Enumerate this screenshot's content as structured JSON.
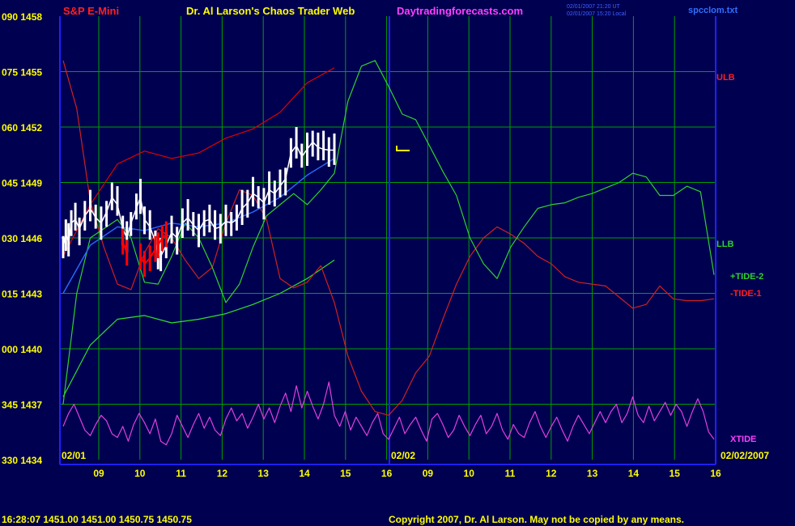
{
  "header": {
    "instrument": "S&P E-Mini",
    "title": "Dr. Al Larson's Chaos Trader Web",
    "site": "Daytradingforecasts.com",
    "stamp_line1": "02/01/2007 21:20 UT",
    "stamp_line2": "02/01/2007 15:20 Local",
    "file": "spcclom.txt"
  },
  "footer": {
    "quote": "16:28:07  1451.00 1451.00 1450.75 1450.75",
    "copyright": "Copyright 2007, Dr. Al Larson. May not be copied by any means."
  },
  "colors": {
    "background": "#000050",
    "grid": "#00a000",
    "axis": "#2020ff",
    "price_bars": "#ffffff",
    "price_bars_down": "#ff0000",
    "ulb_band": "#e00000",
    "llb_band": "#30e030",
    "tide2": "#30d030",
    "tide1": "#d02020",
    "xtide": "#e040e0",
    "avg_line": "#2a6bff",
    "label_yellow": "#ffff00",
    "label_red": "#ff2020",
    "label_magenta": "#ff40ff"
  },
  "chart_data": {
    "type": "line",
    "y_left_labels": [
      "090 1458",
      "075 1455",
      "060 1452",
      "045 1449",
      "030 1446",
      "015 1443",
      "000 1440",
      "345 1437",
      "330 1434"
    ],
    "y_price_values": [
      1458,
      1455,
      1452,
      1449,
      1446,
      1443,
      1440,
      1437,
      1434
    ],
    "ylim": [
      1434,
      1458
    ],
    "x_hour_ticks": [
      "09",
      "10",
      "11",
      "12",
      "13",
      "14",
      "15",
      "16",
      "09",
      "10",
      "11",
      "12",
      "13",
      "14",
      "15",
      "16"
    ],
    "date_labels": [
      "02/01",
      "02/02",
      "02/02/2007"
    ],
    "grid": true,
    "series_labels": [
      {
        "name": "ULB"
      },
      {
        "name": "LLB"
      },
      {
        "name": "+TIDE-2"
      },
      {
        "name": "-TIDE-1"
      },
      {
        "name": "XTIDE"
      }
    ],
    "xlim": [
      0,
      16
    ],
    "price_close": [
      [
        0.0,
        1445.5
      ],
      [
        0.1,
        1446.2
      ],
      [
        0.2,
        1445.8
      ],
      [
        0.3,
        1446.8
      ],
      [
        0.45,
        1447.0
      ],
      [
        0.6,
        1446.5
      ],
      [
        0.8,
        1447.2
      ],
      [
        1.0,
        1447.6
      ],
      [
        1.2,
        1447.1
      ],
      [
        1.4,
        1446.8
      ],
      [
        1.6,
        1447.4
      ],
      [
        1.8,
        1448.2
      ],
      [
        2.0,
        1447.8
      ],
      [
        2.2,
        1446.5
      ],
      [
        2.35,
        1446.0
      ],
      [
        2.5,
        1446.8
      ],
      [
        2.7,
        1447.6
      ],
      [
        2.85,
        1448.2
      ],
      [
        3.0,
        1447.0
      ],
      [
        3.2,
        1446.6
      ],
      [
        3.4,
        1445.8
      ],
      [
        3.5,
        1445.2
      ],
      [
        3.6,
        1445.0
      ],
      [
        3.8,
        1445.6
      ],
      [
        4.0,
        1446.3
      ],
      [
        4.2,
        1446.0
      ],
      [
        4.4,
        1446.8
      ],
      [
        4.6,
        1447.1
      ],
      [
        4.8,
        1446.7
      ],
      [
        5.0,
        1446.4
      ],
      [
        5.2,
        1446.9
      ],
      [
        5.4,
        1447.0
      ],
      [
        5.6,
        1446.5
      ],
      [
        5.8,
        1446.6
      ],
      [
        6.0,
        1446.9
      ],
      [
        6.2,
        1446.8
      ],
      [
        6.4,
        1447.0
      ],
      [
        6.6,
        1447.6
      ],
      [
        6.8,
        1447.9
      ],
      [
        7.0,
        1448.4
      ],
      [
        7.2,
        1448.2
      ],
      [
        7.4,
        1447.9
      ],
      [
        7.6,
        1448.6
      ],
      [
        7.8,
        1448.4
      ],
      [
        8.0,
        1448.8
      ],
      [
        8.2,
        1449.2
      ],
      [
        8.4,
        1450.6
      ],
      [
        8.6,
        1451.0
      ],
      [
        8.8,
        1450.4
      ],
      [
        9.0,
        1450.8
      ],
      [
        9.2,
        1451.2
      ],
      [
        9.4,
        1450.9
      ],
      [
        9.6,
        1450.8
      ],
      [
        9.8,
        1450.75
      ],
      [
        10.0,
        1450.75
      ]
    ],
    "price_down_segments": [
      [
        [
          2.2,
          1445.8
        ],
        [
          2.35,
          1445.2
        ]
      ],
      [
        [
          2.85,
          1445.0
        ],
        [
          3.0,
          1444.6
        ],
        [
          3.2,
          1444.9
        ],
        [
          3.4,
          1445.4
        ]
      ],
      [
        [
          3.5,
          1445.6
        ],
        [
          3.65,
          1446.0
        ],
        [
          3.8,
          1446.2
        ]
      ]
    ],
    "avg_line": [
      [
        0.0,
        1443.0
      ],
      [
        1.0,
        1445.6
      ],
      [
        2.0,
        1446.6
      ],
      [
        3.0,
        1446.4
      ],
      [
        4.0,
        1446.8
      ],
      [
        5.0,
        1446.6
      ],
      [
        6.0,
        1446.8
      ],
      [
        7.0,
        1447.4
      ],
      [
        8.0,
        1448.2
      ],
      [
        9.0,
        1449.4
      ],
      [
        10.0,
        1450.3
      ]
    ],
    "ulb_band": [
      [
        0.0,
        1445.0
      ],
      [
        1.0,
        1447.8
      ],
      [
        2.0,
        1450.0
      ],
      [
        3.0,
        1450.7
      ],
      [
        4.0,
        1450.3
      ],
      [
        5.0,
        1450.6
      ],
      [
        6.0,
        1451.4
      ],
      [
        7.0,
        1451.9
      ],
      [
        8.0,
        1452.8
      ],
      [
        9.0,
        1454.4
      ],
      [
        10.0,
        1455.2
      ]
    ],
    "llb_band": [
      [
        0.0,
        1437.4
      ],
      [
        1.0,
        1440.2
      ],
      [
        2.0,
        1441.6
      ],
      [
        3.0,
        1441.8
      ],
      [
        4.0,
        1441.4
      ],
      [
        5.0,
        1441.6
      ],
      [
        6.0,
        1441.9
      ],
      [
        7.0,
        1442.4
      ],
      [
        8.0,
        1443.0
      ],
      [
        9.0,
        1443.8
      ],
      [
        10.0,
        1444.8
      ]
    ],
    "tide2": [
      [
        0.0,
        1437.0
      ],
      [
        0.5,
        1443.0
      ],
      [
        1.0,
        1446.0
      ],
      [
        1.5,
        1446.5
      ],
      [
        2.0,
        1447.0
      ],
      [
        2.5,
        1446.0
      ],
      [
        3.0,
        1443.6
      ],
      [
        3.5,
        1443.5
      ],
      [
        4.0,
        1445.0
      ],
      [
        4.5,
        1446.8
      ],
      [
        5.0,
        1446.0
      ],
      [
        5.5,
        1444.4
      ],
      [
        6.0,
        1442.5
      ],
      [
        6.5,
        1443.5
      ],
      [
        7.0,
        1445.5
      ],
      [
        7.5,
        1447.2
      ],
      [
        8.0,
        1447.8
      ],
      [
        8.5,
        1448.4
      ],
      [
        9.0,
        1447.8
      ],
      [
        9.5,
        1448.6
      ],
      [
        10.0,
        1449.5
      ],
      [
        10.5,
        1453.4
      ],
      [
        11.0,
        1455.3
      ],
      [
        11.5,
        1455.6
      ],
      [
        12.0,
        1454.2
      ],
      [
        12.5,
        1452.7
      ],
      [
        13.0,
        1452.4
      ],
      [
        13.5,
        1451.0
      ],
      [
        14.0,
        1449.6
      ],
      [
        14.5,
        1448.3
      ],
      [
        15.0,
        1446.0
      ],
      [
        15.5,
        1444.6
      ],
      [
        16.0,
        1443.8
      ],
      [
        16.5,
        1445.5
      ],
      [
        17.0,
        1446.6
      ],
      [
        17.5,
        1447.6
      ],
      [
        18.0,
        1447.8
      ],
      [
        18.5,
        1447.9
      ],
      [
        19.0,
        1448.2
      ],
      [
        19.5,
        1448.4
      ],
      [
        20.0,
        1448.7
      ],
      [
        20.5,
        1449.0
      ],
      [
        21.0,
        1449.5
      ],
      [
        21.5,
        1449.3
      ],
      [
        22.0,
        1448.3
      ],
      [
        22.5,
        1448.3
      ],
      [
        23.0,
        1448.8
      ],
      [
        23.5,
        1448.5
      ],
      [
        24.0,
        1444.0
      ]
    ],
    "tide1": [
      [
        0.0,
        1455.6
      ],
      [
        0.5,
        1453.0
      ],
      [
        1.0,
        1448.0
      ],
      [
        1.5,
        1445.5
      ],
      [
        2.0,
        1443.5
      ],
      [
        2.5,
        1443.2
      ],
      [
        3.0,
        1445.2
      ],
      [
        3.5,
        1446.5
      ],
      [
        4.0,
        1446.0
      ],
      [
        4.5,
        1444.8
      ],
      [
        5.0,
        1443.8
      ],
      [
        5.5,
        1444.4
      ],
      [
        6.0,
        1446.8
      ],
      [
        6.5,
        1448.6
      ],
      [
        7.0,
        1448.3
      ],
      [
        7.5,
        1447.0
      ],
      [
        8.0,
        1443.8
      ],
      [
        8.5,
        1443.3
      ],
      [
        9.0,
        1443.6
      ],
      [
        9.5,
        1444.5
      ],
      [
        10.0,
        1442.5
      ],
      [
        10.5,
        1439.6
      ],
      [
        11.0,
        1437.7
      ],
      [
        11.5,
        1436.6
      ],
      [
        12.0,
        1436.4
      ],
      [
        12.5,
        1437.2
      ],
      [
        13.0,
        1438.7
      ],
      [
        13.5,
        1439.6
      ],
      [
        14.0,
        1441.6
      ],
      [
        14.5,
        1443.5
      ],
      [
        15.0,
        1445.0
      ],
      [
        15.5,
        1446.0
      ],
      [
        16.0,
        1446.6
      ],
      [
        16.5,
        1446.2
      ],
      [
        17.0,
        1445.7
      ],
      [
        17.5,
        1445.0
      ],
      [
        18.0,
        1444.6
      ],
      [
        18.5,
        1443.9
      ],
      [
        19.0,
        1443.6
      ],
      [
        19.5,
        1443.5
      ],
      [
        20.0,
        1443.4
      ],
      [
        20.5,
        1442.8
      ],
      [
        21.0,
        1442.2
      ],
      [
        21.5,
        1442.4
      ],
      [
        22.0,
        1443.4
      ],
      [
        22.5,
        1442.7
      ],
      [
        23.0,
        1442.6
      ],
      [
        23.5,
        1442.6
      ],
      [
        24.0,
        1442.7
      ]
    ],
    "xtide": [
      [
        0.0,
        1435.8
      ],
      [
        0.2,
        1436.5
      ],
      [
        0.4,
        1437.0
      ],
      [
        0.6,
        1436.3
      ],
      [
        0.8,
        1435.6
      ],
      [
        1.0,
        1435.3
      ],
      [
        1.2,
        1435.9
      ],
      [
        1.4,
        1436.4
      ],
      [
        1.6,
        1436.1
      ],
      [
        1.8,
        1435.4
      ],
      [
        2.0,
        1435.2
      ],
      [
        2.2,
        1435.8
      ],
      [
        2.4,
        1435.0
      ],
      [
        2.6,
        1435.9
      ],
      [
        2.8,
        1436.5
      ],
      [
        3.0,
        1436.0
      ],
      [
        3.2,
        1435.4
      ],
      [
        3.4,
        1436.2
      ],
      [
        3.6,
        1435.0
      ],
      [
        3.8,
        1434.8
      ],
      [
        4.0,
        1435.4
      ],
      [
        4.2,
        1436.4
      ],
      [
        4.4,
        1435.8
      ],
      [
        4.6,
        1435.2
      ],
      [
        4.8,
        1435.9
      ],
      [
        5.0,
        1436.5
      ],
      [
        5.2,
        1435.7
      ],
      [
        5.4,
        1436.3
      ],
      [
        5.6,
        1435.6
      ],
      [
        5.8,
        1435.3
      ],
      [
        6.0,
        1436.2
      ],
      [
        6.2,
        1436.8
      ],
      [
        6.4,
        1436.1
      ],
      [
        6.6,
        1436.5
      ],
      [
        6.8,
        1435.7
      ],
      [
        7.0,
        1436.3
      ],
      [
        7.2,
        1437.0
      ],
      [
        7.4,
        1436.2
      ],
      [
        7.6,
        1436.8
      ],
      [
        7.8,
        1436.0
      ],
      [
        8.0,
        1436.9
      ],
      [
        8.2,
        1437.6
      ],
      [
        8.4,
        1436.6
      ],
      [
        8.6,
        1438.0
      ],
      [
        8.8,
        1436.8
      ],
      [
        9.0,
        1437.7
      ],
      [
        9.2,
        1436.9
      ],
      [
        9.4,
        1436.2
      ],
      [
        9.6,
        1437.0
      ],
      [
        9.8,
        1438.2
      ],
      [
        10.0,
        1436.4
      ],
      [
        10.2,
        1435.8
      ],
      [
        10.4,
        1436.6
      ],
      [
        10.6,
        1435.6
      ],
      [
        10.8,
        1436.3
      ],
      [
        11.0,
        1435.8
      ],
      [
        11.2,
        1435.3
      ],
      [
        11.4,
        1436.0
      ],
      [
        11.6,
        1436.5
      ],
      [
        11.8,
        1435.4
      ],
      [
        12.0,
        1435.1
      ],
      [
        12.2,
        1435.7
      ],
      [
        12.4,
        1436.3
      ],
      [
        12.6,
        1435.4
      ],
      [
        12.8,
        1435.9
      ],
      [
        13.0,
        1436.3
      ],
      [
        13.2,
        1435.6
      ],
      [
        13.4,
        1435.0
      ],
      [
        13.6,
        1436.2
      ],
      [
        13.8,
        1436.5
      ],
      [
        14.0,
        1435.9
      ],
      [
        14.2,
        1435.2
      ],
      [
        14.4,
        1435.6
      ],
      [
        14.6,
        1436.4
      ],
      [
        14.8,
        1435.8
      ],
      [
        15.0,
        1435.3
      ],
      [
        15.2,
        1435.9
      ],
      [
        15.4,
        1436.4
      ],
      [
        15.6,
        1435.4
      ],
      [
        15.8,
        1435.8
      ],
      [
        16.0,
        1436.5
      ],
      [
        16.2,
        1435.6
      ],
      [
        16.4,
        1435.1
      ],
      [
        16.6,
        1435.9
      ],
      [
        16.8,
        1435.4
      ],
      [
        17.0,
        1435.2
      ],
      [
        17.2,
        1436.0
      ],
      [
        17.4,
        1436.6
      ],
      [
        17.6,
        1435.8
      ],
      [
        17.8,
        1435.2
      ],
      [
        18.0,
        1435.8
      ],
      [
        18.2,
        1436.3
      ],
      [
        18.4,
        1435.6
      ],
      [
        18.6,
        1435.0
      ],
      [
        18.8,
        1435.8
      ],
      [
        19.0,
        1436.4
      ],
      [
        19.2,
        1435.9
      ],
      [
        19.4,
        1435.4
      ],
      [
        19.6,
        1436.0
      ],
      [
        19.8,
        1436.6
      ],
      [
        20.0,
        1436.0
      ],
      [
        20.2,
        1436.6
      ],
      [
        20.4,
        1437.0
      ],
      [
        20.6,
        1436.0
      ],
      [
        20.8,
        1436.5
      ],
      [
        21.0,
        1437.4
      ],
      [
        21.2,
        1436.4
      ],
      [
        21.4,
        1436.0
      ],
      [
        21.6,
        1436.9
      ],
      [
        21.8,
        1436.1
      ],
      [
        22.0,
        1436.6
      ],
      [
        22.2,
        1437.1
      ],
      [
        22.4,
        1436.4
      ],
      [
        22.6,
        1437.0
      ],
      [
        22.8,
        1436.6
      ],
      [
        23.0,
        1435.8
      ],
      [
        23.2,
        1436.6
      ],
      [
        23.4,
        1437.3
      ],
      [
        23.6,
        1436.6
      ],
      [
        23.8,
        1435.5
      ],
      [
        24.0,
        1435.1
      ]
    ]
  }
}
